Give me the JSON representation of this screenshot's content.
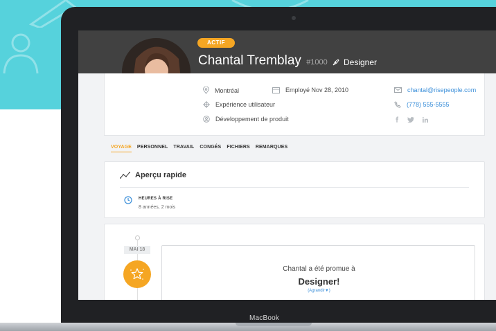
{
  "laptop": {
    "brand_label": "MacBook"
  },
  "profile": {
    "status": "ACTIF",
    "name": "Chantal Tremblay",
    "employee_id": "#1000",
    "role": "Designer",
    "location": "Montréal",
    "hired": "Employé Nov 28, 2010",
    "department": "Expérience utilisateur",
    "team": "Développement de produit",
    "email": "chantal@risepeople.com",
    "phone": "(778) 555-5555",
    "social": [
      "facebook-icon",
      "twitter-icon",
      "linkedin-icon"
    ]
  },
  "tabs": [
    {
      "label": "VOYAGE",
      "active": true
    },
    {
      "label": "PERSONNEL",
      "active": false
    },
    {
      "label": "TRAVAIL",
      "active": false
    },
    {
      "label": "CONGÉS",
      "active": false
    },
    {
      "label": "FICHIERS",
      "active": false
    },
    {
      "label": "REMARQUES",
      "active": false
    }
  ],
  "quick_view": {
    "title": "Aperçu rapide",
    "hours_label": "HEURES À RISE",
    "hours_value": "8 années, 2 mois"
  },
  "timeline": {
    "date": "MAI 18",
    "event_text": "Chantal a été promue à",
    "event_role": "Designer!",
    "expand_label": "(Agrandir▼)"
  },
  "colors": {
    "teal": "#56d2dc",
    "accent": "#f5a623",
    "header": "#414141",
    "link": "#3b8fd9"
  }
}
